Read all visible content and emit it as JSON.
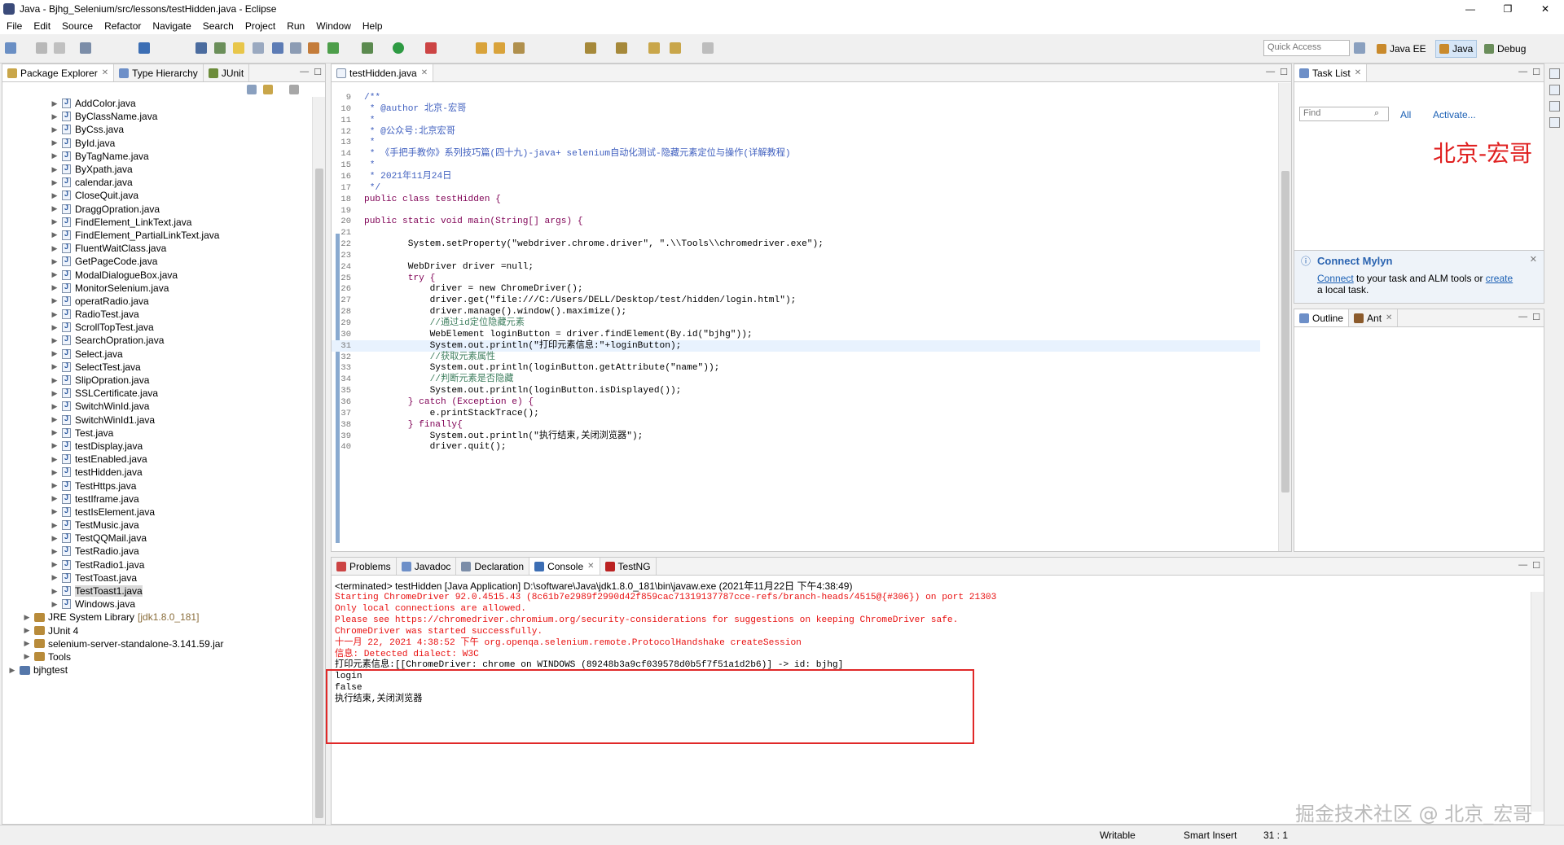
{
  "window": {
    "title": "Java - Bjhg_Selenium/src/lessons/testHidden.java - Eclipse",
    "controls": [
      "—",
      "❐",
      "✕"
    ]
  },
  "menu": [
    "File",
    "Edit",
    "Source",
    "Refactor",
    "Navigate",
    "Search",
    "Project",
    "Run",
    "Window",
    "Help"
  ],
  "toolbar": {
    "quick_access_placeholder": "Quick Access",
    "perspectives": [
      "Java EE",
      "Java",
      "Debug"
    ],
    "active_perspective": "Java"
  },
  "package_explorer": {
    "tabs": [
      "Package Explorer",
      "Type Hierarchy",
      "JUnit"
    ],
    "files": [
      "AddColor.java",
      "ByClassName.java",
      "ByCss.java",
      "ById.java",
      "ByTagName.java",
      "ByXpath.java",
      "calendar.java",
      "CloseQuit.java",
      "DraggOpration.java",
      "FindElement_LinkText.java",
      "FindElement_PartialLinkText.java",
      "FluentWaitClass.java",
      "GetPageCode.java",
      "ModalDialogueBox.java",
      "MonitorSelenium.java",
      "operatRadio.java",
      "RadioTest.java",
      "ScrollTopTest.java",
      "SearchOpration.java",
      "Select.java",
      "SelectTest.java",
      "SlipOpration.java",
      "SSLCertificate.java",
      "SwitchWinId.java",
      "SwitchWinId1.java",
      "Test.java",
      "testDisplay.java",
      "testEnabled.java",
      "testHidden.java",
      "TestHttps.java",
      "testIframe.java",
      "testIsElement.java",
      "TestMusic.java",
      "TestQQMail.java",
      "TestRadio.java",
      "TestRadio1.java",
      "TestToast.java",
      "TestToast1.java",
      "Windows.java"
    ],
    "selected_file": "TestToast1.java",
    "libraries": [
      {
        "name": "JRE System Library",
        "decoration": "[jdk1.8.0_181]"
      },
      {
        "name": "JUnit 4",
        "decoration": ""
      },
      {
        "name": "selenium-server-standalone-3.141.59.jar",
        "decoration": ""
      },
      {
        "name": "Tools",
        "decoration": ""
      }
    ],
    "projects": [
      "bjhgtest"
    ]
  },
  "editor": {
    "tab": "testHidden.java",
    "lines": [
      {
        "n": "9",
        "t": "/**"
      },
      {
        "n": "10",
        "t": " * @author 北京-宏哥"
      },
      {
        "n": "11",
        "t": " *"
      },
      {
        "n": "12",
        "t": " * @公众号:北京宏哥"
      },
      {
        "n": "13",
        "t": " *"
      },
      {
        "n": "14",
        "t": " * 《手把手教你》系列技巧篇(四十九)-java+ selenium自动化测试-隐藏元素定位与操作(详解教程)"
      },
      {
        "n": "15",
        "t": " *"
      },
      {
        "n": "16",
        "t": " * 2021年11月24日"
      },
      {
        "n": "17",
        "t": " */"
      },
      {
        "n": "18",
        "t": "public class testHidden {"
      },
      {
        "n": "19",
        "t": ""
      },
      {
        "n": "20",
        "t": "public static void main(String[] args) {"
      },
      {
        "n": "21",
        "t": ""
      },
      {
        "n": "22",
        "t": "        System.setProperty(\"webdriver.chrome.driver\", \".\\\\Tools\\\\chromedriver.exe\");"
      },
      {
        "n": "23",
        "t": ""
      },
      {
        "n": "24",
        "t": "        WebDriver driver =null;"
      },
      {
        "n": "25",
        "t": "        try {"
      },
      {
        "n": "26",
        "t": "            driver = new ChromeDriver();"
      },
      {
        "n": "27",
        "t": "            driver.get(\"file:///C:/Users/DELL/Desktop/test/hidden/login.html\");"
      },
      {
        "n": "28",
        "t": "            driver.manage().window().maximize();"
      },
      {
        "n": "29",
        "t": "            //通过id定位隐藏元素"
      },
      {
        "n": "30",
        "t": "            WebElement loginButton = driver.findElement(By.id(\"bjhg\"));"
      },
      {
        "n": "31",
        "t": "            System.out.println(\"打印元素信息:\"+loginButton);"
      },
      {
        "n": "32",
        "t": "            //获取元素属性"
      },
      {
        "n": "33",
        "t": "            System.out.println(loginButton.getAttribute(\"name\"));"
      },
      {
        "n": "34",
        "t": "            //判断元素是否隐藏"
      },
      {
        "n": "35",
        "t": "            System.out.println(loginButton.isDisplayed());"
      },
      {
        "n": "36",
        "t": "        } catch (Exception e) {"
      },
      {
        "n": "37",
        "t": "            e.printStackTrace();"
      },
      {
        "n": "38",
        "t": "        } finally{"
      },
      {
        "n": "39",
        "t": "            System.out.println(\"执行结束,关闭浏览器\");"
      },
      {
        "n": "40",
        "t": "            driver.quit();"
      }
    ]
  },
  "task_list": {
    "tab": "Task List",
    "find_placeholder": "Find",
    "filter_all": "All",
    "activate": "Activate...",
    "watermark": "北京-宏哥"
  },
  "mylyn": {
    "title": "Connect Mylyn",
    "connect": "Connect",
    "text_mid": " to your task and ALM tools or ",
    "create": "create",
    "text_end": "a local task."
  },
  "outline": {
    "tabs": [
      "Outline",
      "Ant"
    ]
  },
  "console": {
    "tabs": [
      "Problems",
      "Javadoc",
      "Declaration",
      "Console",
      "TestNG"
    ],
    "header": "<terminated> testHidden [Java Application] D:\\software\\Java\\jdk1.8.0_181\\bin\\javaw.exe (2021年11月22日 下午4:38:49)",
    "lines": [
      {
        "t": "Starting ChromeDriver 92.0.4515.43 (8c61b7e2989f2990d42f859cac71319137787cce-refs/branch-heads/4515@{#306}) on port 21303",
        "k": "err"
      },
      {
        "t": "Only local connections are allowed.",
        "k": "err"
      },
      {
        "t": "Please see https://chromedriver.chromium.org/security-considerations for suggestions on keeping ChromeDriver safe.",
        "k": "err"
      },
      {
        "t": "ChromeDriver was started successfully.",
        "k": "err"
      },
      {
        "t": "十一月 22, 2021 4:38:52 下午 org.openqa.selenium.remote.ProtocolHandshake createSession",
        "k": "err"
      },
      {
        "t": "信息: Detected dialect: W3C",
        "k": "err"
      },
      {
        "t": "打印元素信息:[[ChromeDriver: chrome on WINDOWS (89248b3a9cf039578d0b5f7f51a1d2b6)] -> id: bjhg]",
        "k": "out"
      },
      {
        "t": "login",
        "k": "out"
      },
      {
        "t": "false",
        "k": "out"
      },
      {
        "t": "执行结束,关闭浏览器",
        "k": "out"
      }
    ]
  },
  "status": {
    "writable": "Writable",
    "insert_mode": "Smart Insert",
    "position": "31 : 1"
  },
  "watermark_bottom": "掘金技术社区 @ 北京_宏哥"
}
